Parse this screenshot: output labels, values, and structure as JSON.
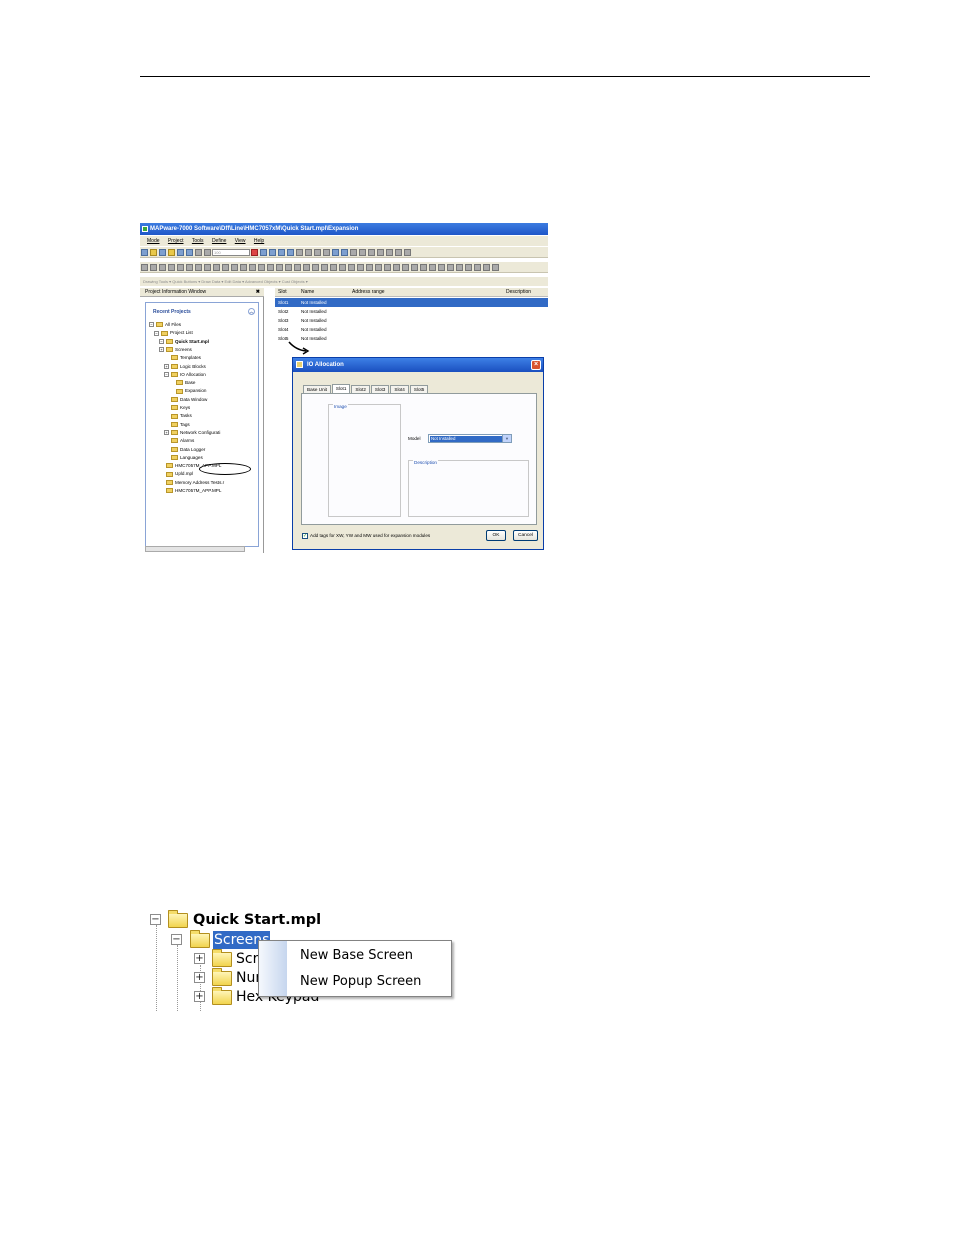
{
  "screenshot1": {
    "window_title": "MAPware-7000 Software\\Dff\\Line\\HMC7057xM\\Quick Start.mpl\\Expansion",
    "menu": [
      "Mode",
      "Project",
      "Tools",
      "Define",
      "View",
      "Help"
    ],
    "zoom_value": "100",
    "toolbar_tabs": "Drawing Tools  ▾  Quick Buttons  ▾  Draw Data  ▾  Edit Data  ▾  Advanced Objects  ▾  Cust Objects  ▾",
    "left_pane": {
      "title": "Project Information Window",
      "close": "✖",
      "section": "Recent Projects",
      "tree": [
        {
          "pm": "−",
          "label": "All Files"
        },
        {
          "pm": "−",
          "label": "Project List"
        },
        {
          "pm": "−",
          "label": "Quick Start.mpl"
        },
        {
          "pm": "+",
          "label": "Screens"
        },
        {
          "pm": "",
          "label": "Templates"
        },
        {
          "pm": "+",
          "label": "Logic Blocks"
        },
        {
          "pm": "−",
          "label": "IO Allocation"
        },
        {
          "pm": "",
          "label": "Base"
        },
        {
          "pm": "",
          "label": "Expansion"
        },
        {
          "pm": "",
          "label": "Data Window"
        },
        {
          "pm": "",
          "label": "Keys"
        },
        {
          "pm": "",
          "label": "Tasks"
        },
        {
          "pm": "",
          "label": "Tags"
        },
        {
          "pm": "+",
          "label": "Network Configurati"
        },
        {
          "pm": "",
          "label": "Alarms"
        },
        {
          "pm": "",
          "label": "Data Logger"
        },
        {
          "pm": "",
          "label": "Languages"
        },
        {
          "pm": "",
          "label": "HMC7057M_APP.MPL"
        },
        {
          "pm": "",
          "label": "Upld.mpl"
        },
        {
          "pm": "",
          "label": "Memory Address Tests.r"
        },
        {
          "pm": "",
          "label": "HMC7057M_APP.MPL"
        }
      ]
    },
    "grid": {
      "headers": [
        "Slot",
        "Name",
        "Address range",
        "Description"
      ],
      "rows": [
        {
          "slot": "Slot1",
          "name": "Not Installed"
        },
        {
          "slot": "Slot2",
          "name": "Not Installed"
        },
        {
          "slot": "Slot3",
          "name": "Not Installed"
        },
        {
          "slot": "Slot4",
          "name": "Not Installed"
        },
        {
          "slot": "Slot5",
          "name": "Not Installed"
        }
      ]
    },
    "dialog": {
      "title": "IO Allocation",
      "tabs": [
        "Base Unit",
        "Slot1",
        "Slot2",
        "Slot3",
        "Slot4",
        "Slot5"
      ],
      "image_label": "Image",
      "model_label": "Model",
      "model_value": "Not Installed",
      "description_label": "Description",
      "checkbox_label": "Add tags for XW, YW and MW used for expansion modules",
      "ok": "OK",
      "cancel": "Cancel"
    }
  },
  "screenshot2": {
    "project": "Quick Start.mpl",
    "screens": "Screens",
    "children": [
      "Scre",
      "Num",
      "Hex Keypad"
    ],
    "context_menu": [
      "New Base Screen",
      "New Popup Screen"
    ]
  },
  "colors": {
    "selection": "#316ac5",
    "title_bar": "#2a62d4",
    "folder": "#f0d060"
  }
}
